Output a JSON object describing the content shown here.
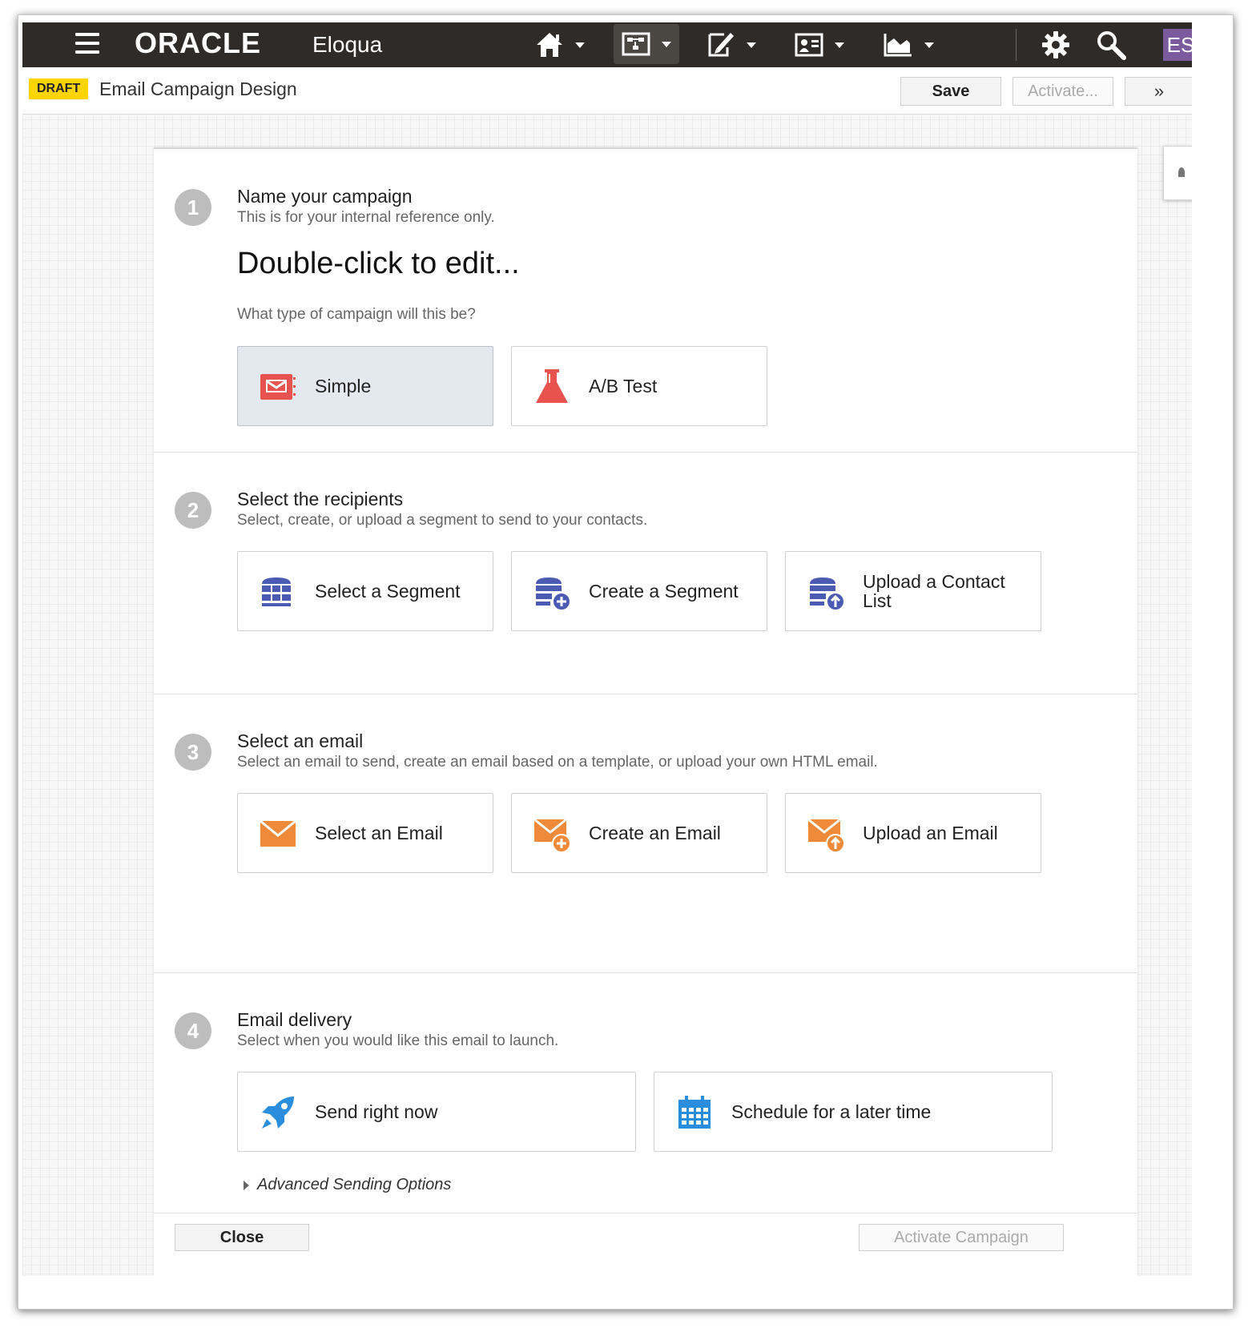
{
  "nav": {
    "logo": "ORACLE",
    "product": "Eloqua",
    "icons": [
      "menu-icon",
      "home-icon",
      "orchestration-icon",
      "assets-icon",
      "contacts-icon",
      "insight-icon",
      "settings-icon",
      "search-icon"
    ],
    "user_initials": "ES",
    "avatar_color": "#7b5a9e"
  },
  "header": {
    "status_badge": "DRAFT",
    "title": "Email Campaign Design",
    "save_label": "Save",
    "activate_label": "Activate...",
    "more_label": "»"
  },
  "steps": [
    {
      "number": "1",
      "title": "Name your campaign",
      "subtitle": "This is for your internal reference only.",
      "campaign_name": "Double-click to edit...",
      "question": "What type of campaign will this be?",
      "options": [
        {
          "label": "Simple",
          "icon": "email-icon",
          "selected": true
        },
        {
          "label": "A/B Test",
          "icon": "flask-icon"
        }
      ]
    },
    {
      "number": "2",
      "title": "Select the recipients",
      "subtitle": "Select, create, or upload a segment to send to your contacts.",
      "options": [
        {
          "label": "Select a Segment",
          "icon": "segment-icon"
        },
        {
          "label": "Create a Segment",
          "icon": "segment-add-icon"
        },
        {
          "label": "Upload a Contact List",
          "icon": "segment-upload-icon"
        }
      ]
    },
    {
      "number": "3",
      "title": "Select an email",
      "subtitle": "Select an email to send, create an email based on a template, or upload your own HTML email.",
      "options": [
        {
          "label": "Select an Email",
          "icon": "envelope-icon"
        },
        {
          "label": "Create an Email",
          "icon": "envelope-add-icon"
        },
        {
          "label": "Upload an Email",
          "icon": "envelope-upload-icon"
        }
      ]
    },
    {
      "number": "4",
      "title": "Email delivery",
      "subtitle": "Select when you would like this email to launch.",
      "options": [
        {
          "label": "Send right now",
          "icon": "rocket-icon"
        },
        {
          "label": "Schedule for a later time",
          "icon": "calendar-icon"
        }
      ],
      "advanced": "Advanced Sending Options"
    }
  ],
  "footer": {
    "close_label": "Close",
    "activate_campaign_label": "Activate Campaign"
  },
  "colors": {
    "nav_bg": "#2f2b28",
    "draft_badge": "#ffd400",
    "red_icon": "#e8534f",
    "segment_icon": "#4b5ab2",
    "email_icon": "#f08a3b",
    "blue_icon": "#2a8dde",
    "selected_bg": "#e4e9f0"
  }
}
